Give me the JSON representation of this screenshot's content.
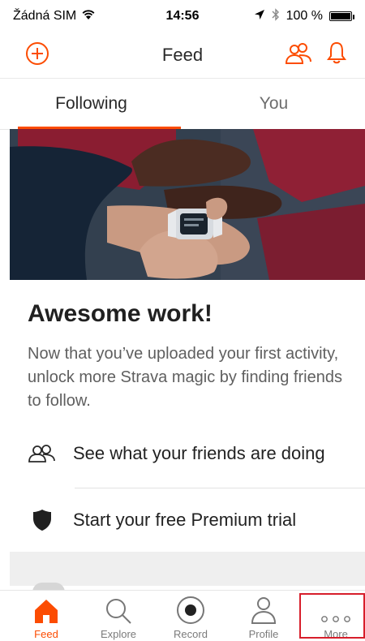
{
  "status_bar": {
    "carrier": "Žádná SIM",
    "time": "14:56",
    "battery_percent": "100 %"
  },
  "top_nav": {
    "title": "Feed",
    "icons": [
      "add-icon",
      "friends-icon",
      "bell-icon"
    ]
  },
  "tabs": [
    {
      "label": "Following",
      "active": true
    },
    {
      "label": "You",
      "active": false
    }
  ],
  "card": {
    "title": "Awesome work!",
    "body": "Now that you’ve uploaded your first activity, unlock more Strava magic by finding friends to follow.",
    "rows": [
      {
        "label": "See what your friends are doing",
        "icon": "people-icon"
      },
      {
        "label": "Start your free Premium trial",
        "icon": "shield-icon"
      }
    ]
  },
  "bottom_tabs": [
    {
      "label": "Feed",
      "icon": "home-icon",
      "active": true
    },
    {
      "label": "Explore",
      "icon": "search-icon",
      "active": false
    },
    {
      "label": "Record",
      "icon": "record-icon",
      "active": false
    },
    {
      "label": "Profile",
      "icon": "profile-icon",
      "active": false
    },
    {
      "label": "More",
      "icon": "more-icon",
      "active": false
    }
  ],
  "colors": {
    "accent": "#fc4c02",
    "highlight": "#d71e2b"
  }
}
